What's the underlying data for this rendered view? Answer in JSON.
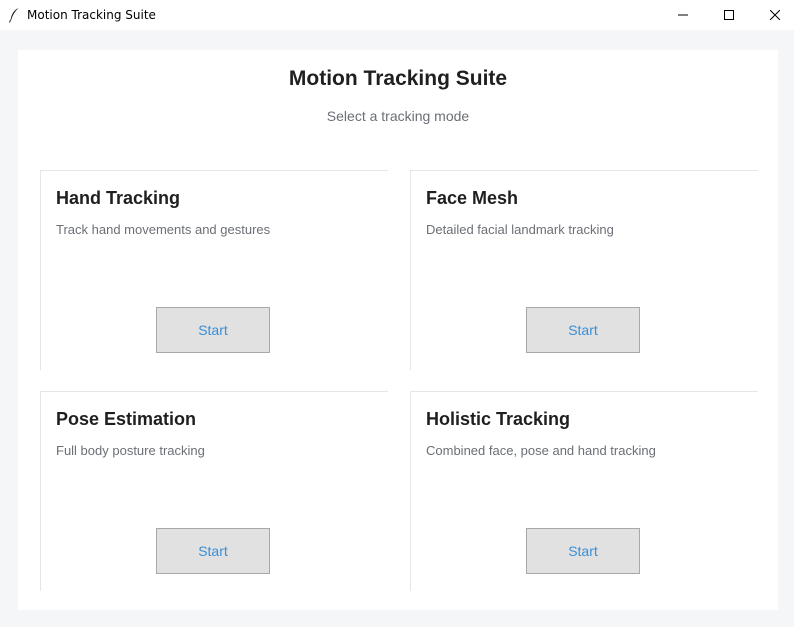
{
  "window": {
    "title": "Motion Tracking Suite",
    "icon": "feather-icon",
    "controls": [
      "minimize-icon",
      "maximize-icon",
      "close-icon"
    ]
  },
  "header": {
    "title": "Motion Tracking Suite",
    "subtitle": "Select a tracking mode"
  },
  "modes": [
    {
      "title": "Hand Tracking",
      "description": "Track hand movements and gestures",
      "button": "Start"
    },
    {
      "title": "Face Mesh",
      "description": "Detailed facial landmark tracking",
      "button": "Start"
    },
    {
      "title": "Pose Estimation",
      "description": "Full body posture tracking",
      "button": "Start"
    },
    {
      "title": "Holistic Tracking",
      "description": "Combined face, pose and hand tracking",
      "button": "Start"
    }
  ],
  "colors": {
    "background": "#f5f6f8",
    "panel": "#ffffff",
    "button_bg": "#e1e1e1",
    "button_text": "#3a8fd6",
    "title_text": "#1f1f1f",
    "muted_text": "#6b6f76"
  }
}
